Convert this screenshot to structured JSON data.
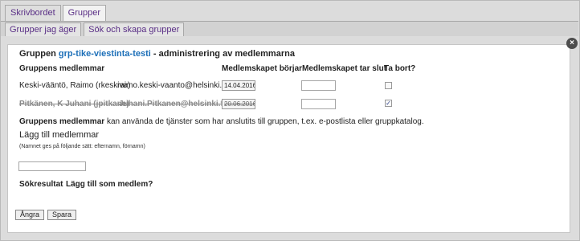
{
  "tabs": [
    "Skrivbordet",
    "Grupper"
  ],
  "subtabs": [
    "Grupper jag äger",
    "Sök och skapa grupper"
  ],
  "close_symbol": "×",
  "title": {
    "prefix": "Gruppen",
    "group": "grp-tike-viestinta-testi",
    "suffix": "- administrering av medlemmarna"
  },
  "columns": {
    "members": "Gruppens medlemmar",
    "start": "Medlemskapet börjar",
    "end": "Medlemskapet tar slut",
    "remove": "Ta bort?"
  },
  "members": [
    {
      "name": "Keski-vääntö, Raimo (rkeskiva)",
      "email": "raimo.keski-vaanto@helsinki.fi",
      "start": "14.04.2016",
      "end": "",
      "remove": false
    },
    {
      "name": "Pitkänen, K Juhani (jpitkane)",
      "email": "Juhani.Pitkanen@helsinki.fi",
      "start": "20.06.2016",
      "end": "",
      "remove": true
    }
  ],
  "info": {
    "bold": "Gruppens medlemmar",
    "rest": "kan använda de tjänster som har anslutits till gruppen, t.ex. e-postlista eller gruppkatalog."
  },
  "add": {
    "heading": "Lägg till medlemmar",
    "hint": "(Namnet ges på följande sätt: efternamn, förnamn)",
    "search_value": ""
  },
  "results": {
    "col1": "Sökresultat",
    "col2": "Lägg till som medlem?"
  },
  "buttons": {
    "cancel": "Ångra",
    "save": "Spara"
  },
  "colors": {
    "group_link": "#1c6fb8",
    "tab_text": "#5a2f86"
  }
}
